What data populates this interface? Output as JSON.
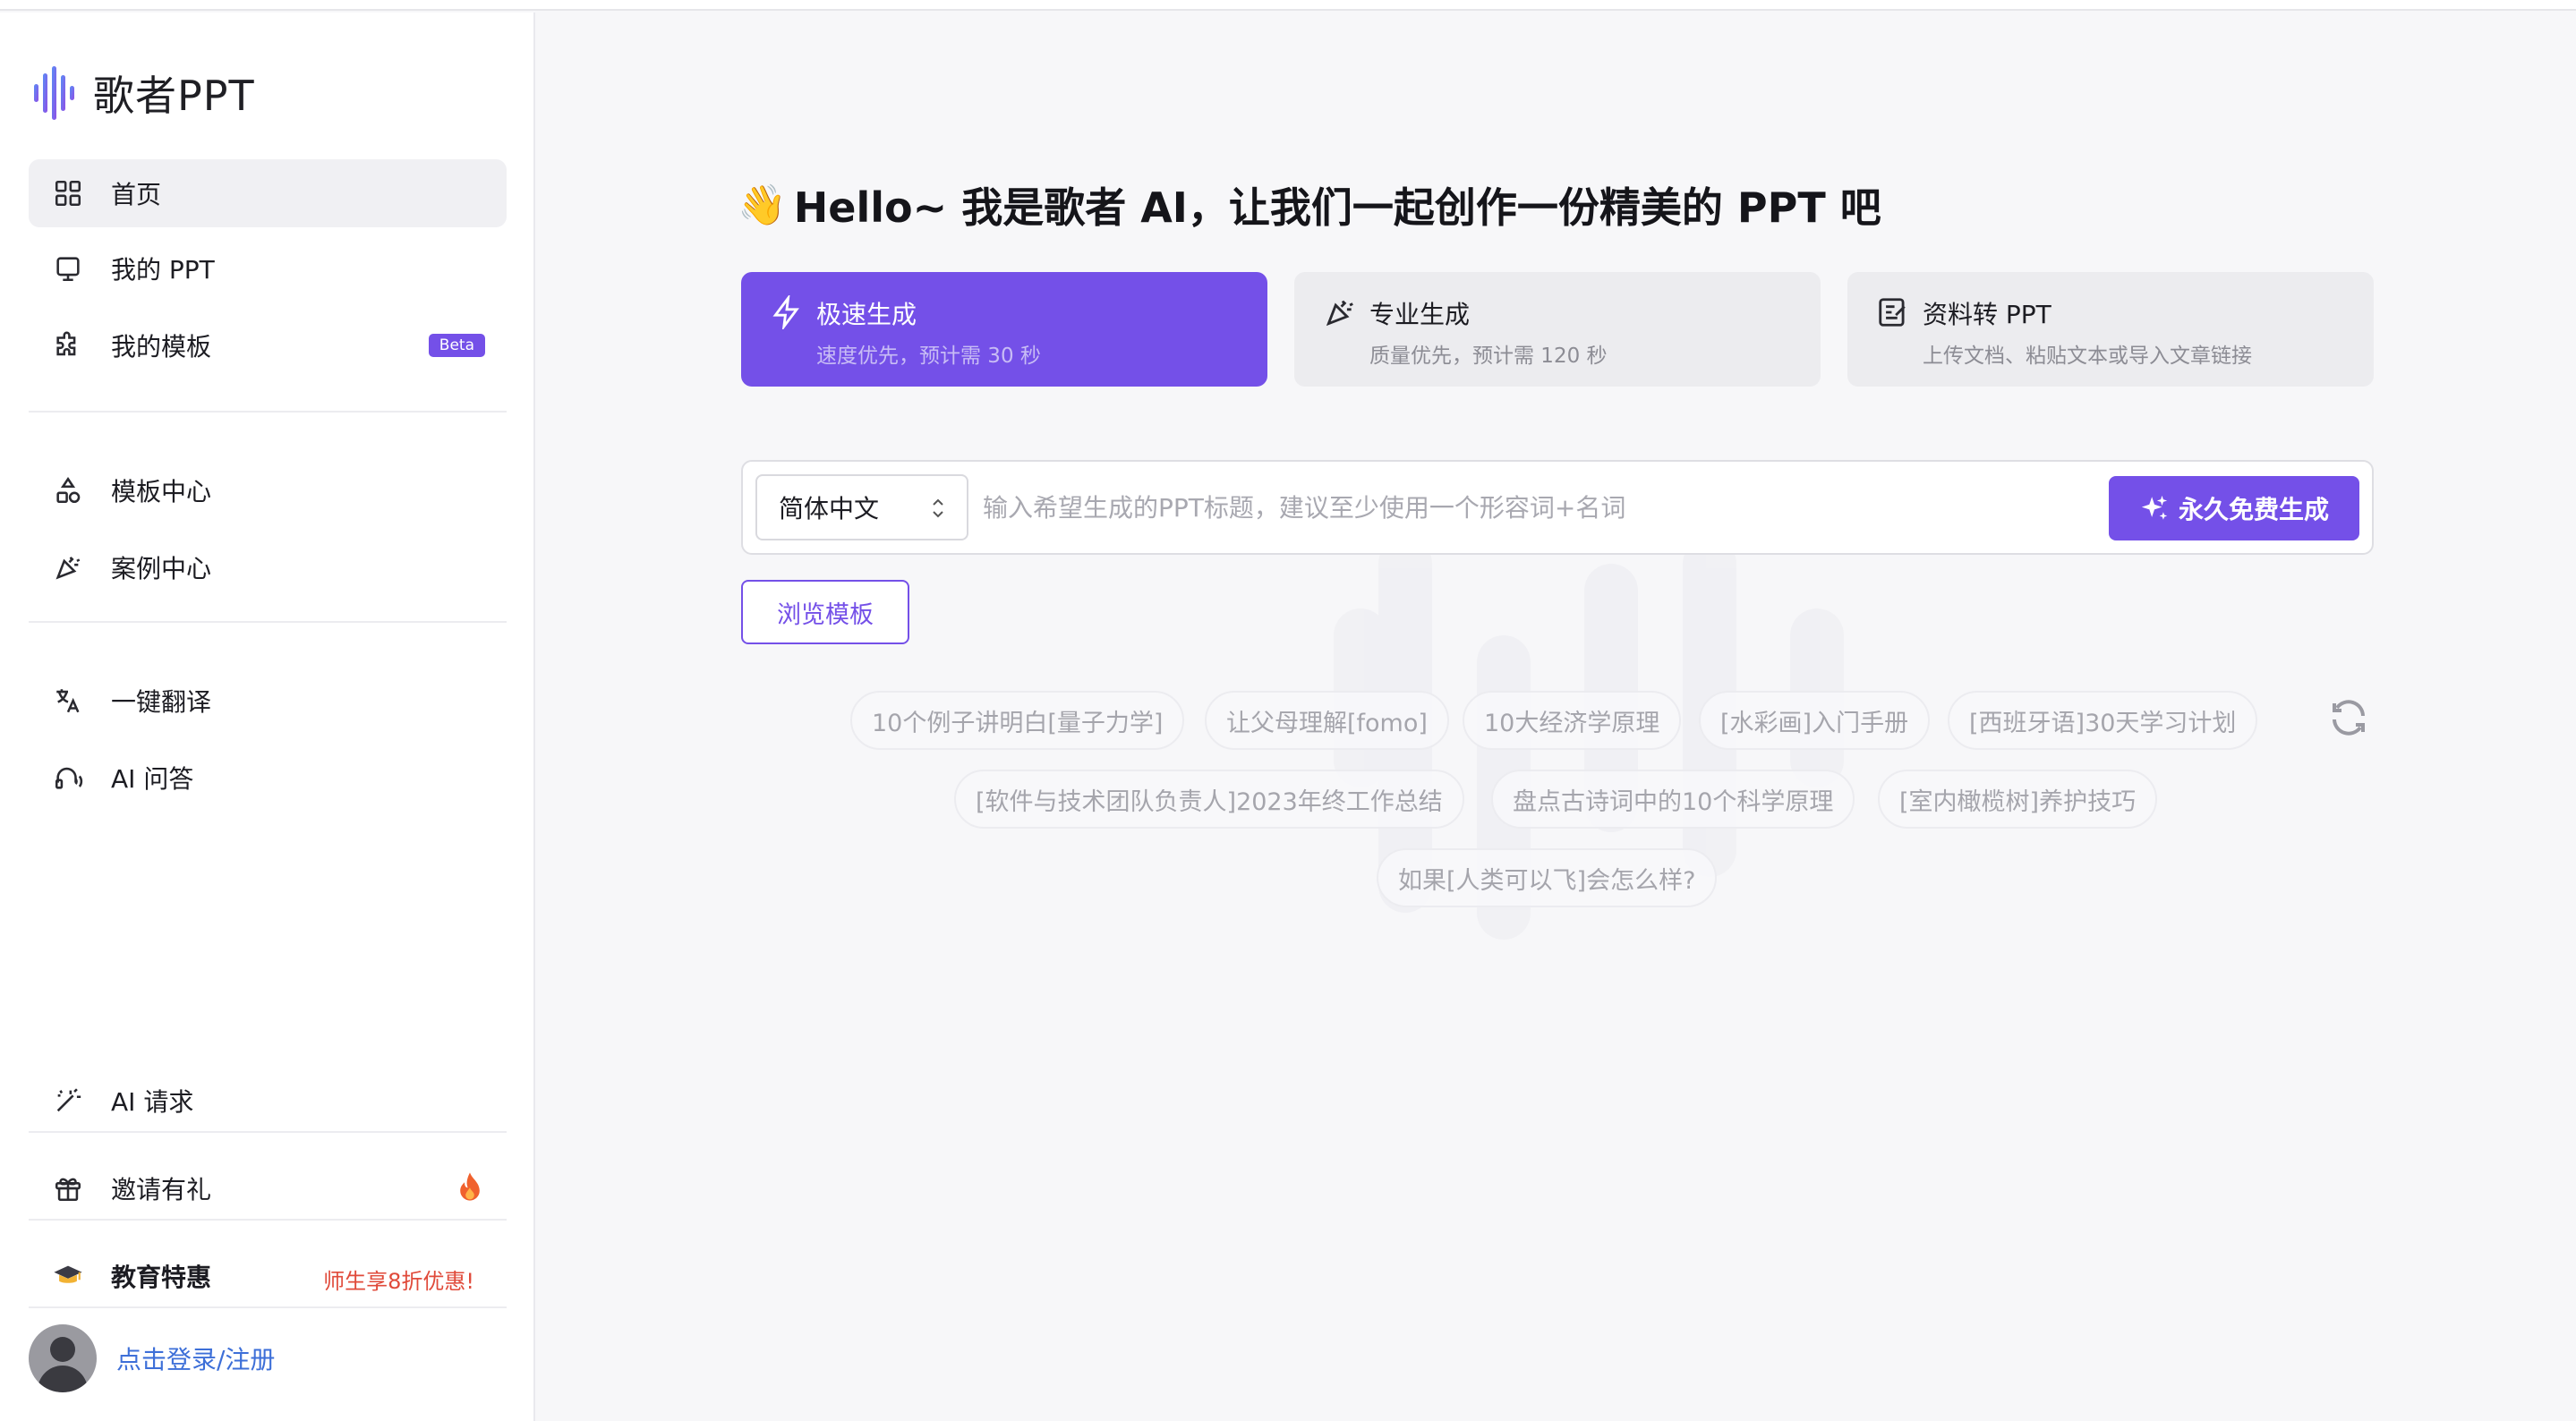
{
  "app": {
    "name": "歌者PPT"
  },
  "sidebar": {
    "nav": [
      {
        "label": "首页",
        "icon": "grid-icon"
      },
      {
        "label": "我的 PPT",
        "icon": "monitor-icon"
      },
      {
        "label": "我的模板",
        "icon": "puzzle-icon",
        "badge": "Beta"
      },
      {
        "label": "模板中心",
        "icon": "shapes-icon"
      },
      {
        "label": "案例中心",
        "icon": "party-popper-icon"
      },
      {
        "label": "一键翻译",
        "icon": "translate-icon"
      },
      {
        "label": "AI 问答",
        "icon": "headset-icon"
      },
      {
        "label": "AI 请求",
        "icon": "magic-wand-icon"
      },
      {
        "label": "邀请有礼",
        "icon": "gift-icon"
      },
      {
        "label": "教育特惠",
        "icon": "graduation-cap-icon",
        "promo": "师生享8折优惠!"
      }
    ],
    "login": "点击登录/注册"
  },
  "main": {
    "greeting": "Hello~ 我是歌者 AI，让我们一起创作一份精美的 PPT 吧",
    "modes": [
      {
        "title": "极速生成",
        "subtitle": "速度优先，预计需 30 秒",
        "icon": "lightning-icon",
        "active": true
      },
      {
        "title": "专业生成",
        "subtitle": "质量优先，预计需 120 秒",
        "icon": "party-popper-icon",
        "active": false
      },
      {
        "title": "资料转 PPT",
        "subtitle": "上传文档、粘贴文本或导入文章链接",
        "icon": "edit-doc-icon",
        "active": false
      }
    ],
    "language": {
      "selected": "简体中文"
    },
    "prompt": {
      "placeholder": "输入希望生成的PPT标题，建议至少使用一个形容词+名词",
      "value": ""
    },
    "generate_label": "永久免费生成",
    "browse_label": "浏览模板",
    "suggestions": [
      "10个例子讲明白[量子力学]",
      "让父母理解[fomo]",
      "10大经济学原理",
      "[水彩画]入门手册",
      "[西班牙语]30天学习计划",
      "[软件与技术团队负责人]2023年终工作总结",
      "盘点古诗词中的10个科学原理",
      "[室内橄榄树]养护技巧",
      "如果[人类可以飞]会怎么样?"
    ]
  },
  "colors": {
    "accent": "#7450e8",
    "promo": "#e04a3a",
    "link": "#3d6fd8"
  }
}
